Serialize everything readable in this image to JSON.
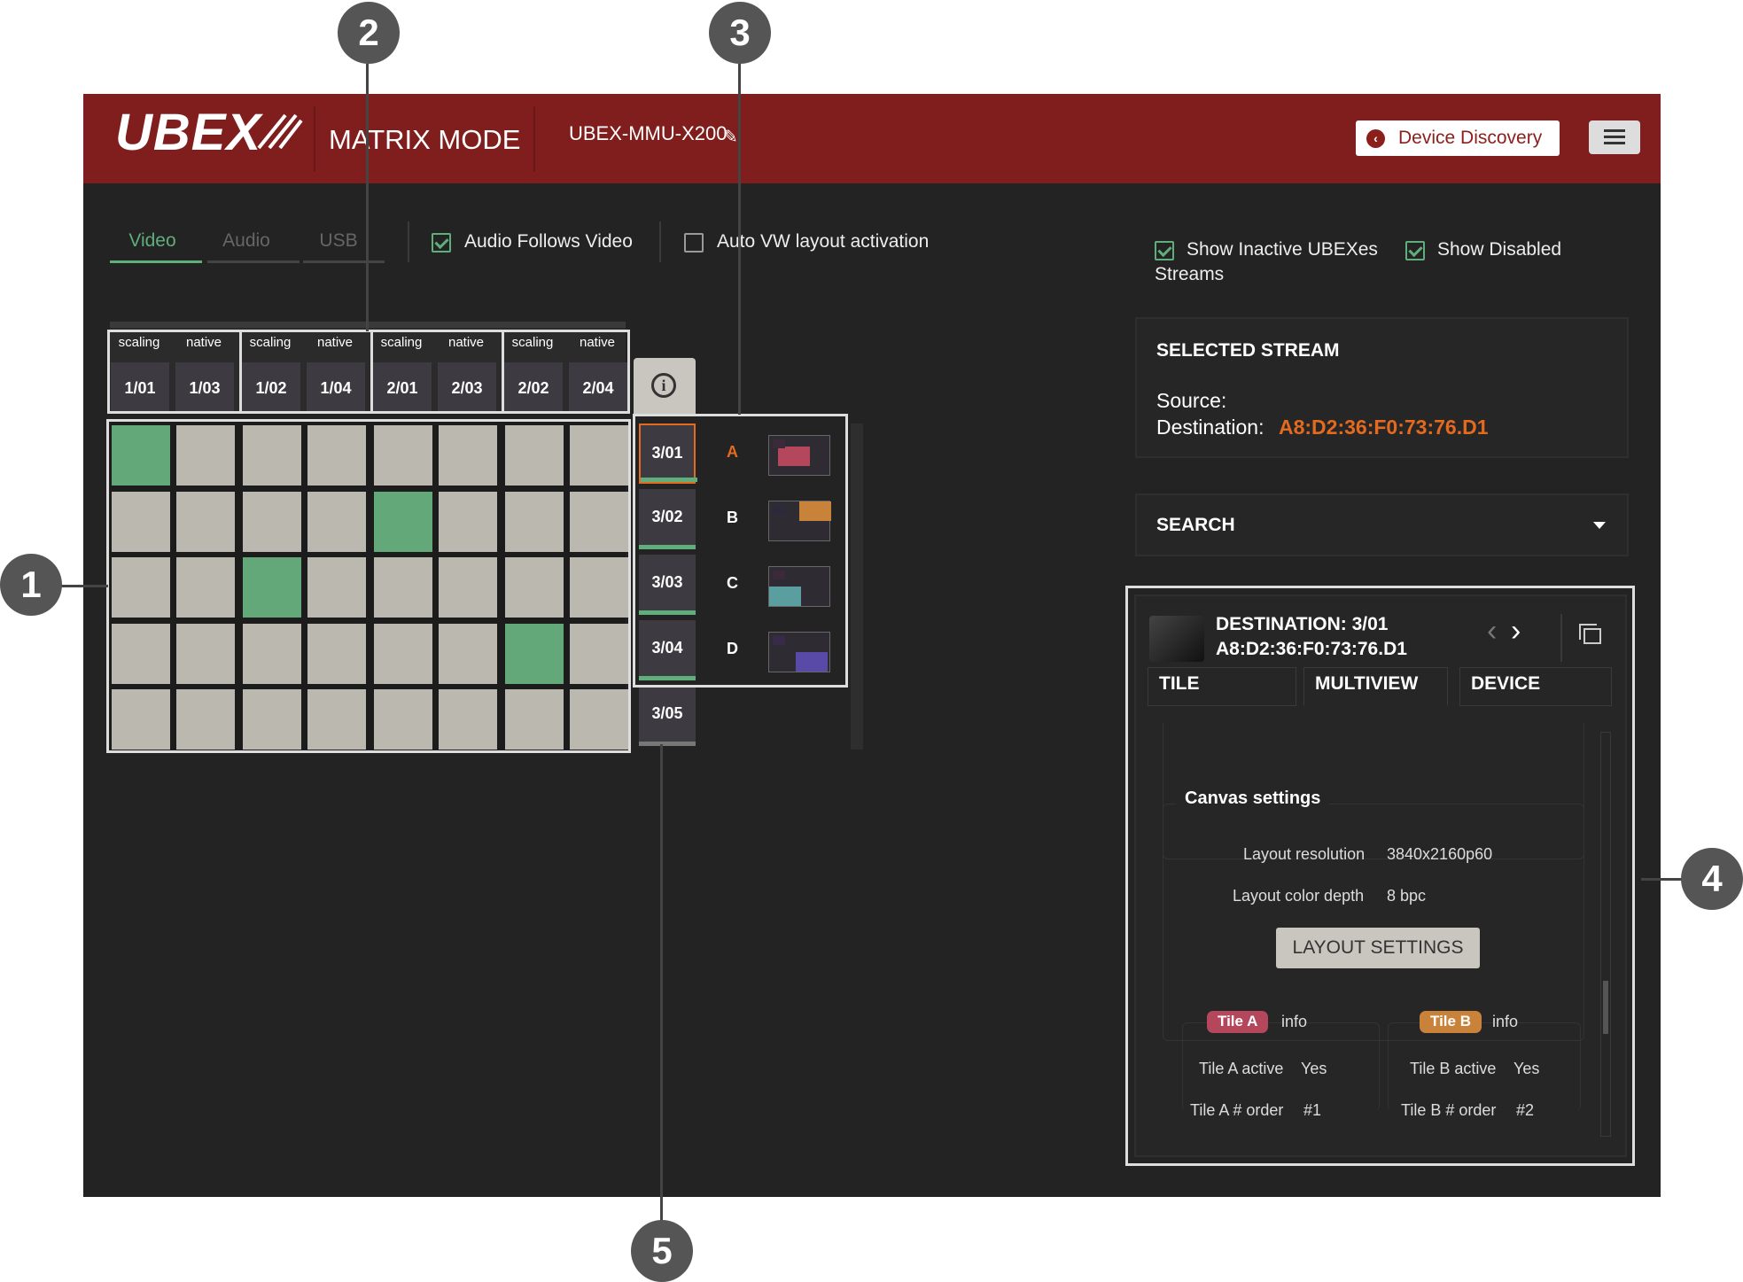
{
  "header": {
    "logo": "UBEX",
    "mode": "MATRIX MODE",
    "device_name": "UBEX-MMU-X200",
    "discovery_label": "Device Discovery"
  },
  "tabs": [
    {
      "label": "Video",
      "active": true
    },
    {
      "label": "Audio",
      "active": false
    },
    {
      "label": "USB",
      "active": false
    }
  ],
  "options": {
    "audio_follows_video": {
      "label": "Audio Follows Video",
      "checked": true
    },
    "auto_vw": {
      "label": "Auto VW layout activation",
      "checked": false
    },
    "show_inactive": {
      "label": "Show Inactive UBEXes",
      "checked": true
    },
    "show_disabled": {
      "label": "Show Disabled",
      "checked": true
    },
    "streams_label": "Streams"
  },
  "sources": [
    {
      "mode": "scaling",
      "id": "1/01"
    },
    {
      "mode": "native",
      "id": "1/03"
    },
    {
      "mode": "scaling",
      "id": "1/02"
    },
    {
      "mode": "native",
      "id": "1/04"
    },
    {
      "mode": "scaling",
      "id": "2/01"
    },
    {
      "mode": "native",
      "id": "2/03"
    },
    {
      "mode": "scaling",
      "id": "2/02"
    },
    {
      "mode": "native",
      "id": "2/04"
    }
  ],
  "destinations": [
    {
      "id": "3/01",
      "tile": "A"
    },
    {
      "id": "3/02",
      "tile": "B"
    },
    {
      "id": "3/03",
      "tile": "C"
    },
    {
      "id": "3/04",
      "tile": "D"
    },
    {
      "id": "3/05",
      "tile": ""
    }
  ],
  "crosspoints": [
    [
      0,
      0
    ],
    [
      1,
      4
    ],
    [
      2,
      2
    ],
    [
      3,
      6
    ]
  ],
  "selected_stream": {
    "title": "SELECTED STREAM",
    "source_label": "Source:",
    "destination_label": "Destination:",
    "destination_value": "A8:D2:36:F0:73:76.D1"
  },
  "search": {
    "label": "SEARCH"
  },
  "destination_panel": {
    "title": "DESTINATION: 3/01",
    "address": "A8:D2:36:F0:73:76.D1",
    "tabs": [
      "TILE",
      "MULTIVIEW",
      "DEVICE"
    ],
    "canvas_title": "Canvas settings",
    "layout_resolution_label": "Layout resolution",
    "layout_resolution_value": "3840x2160p60",
    "color_depth_label": "Layout color depth",
    "color_depth_value": "8 bpc",
    "layout_settings_btn": "LAYOUT SETTINGS",
    "tile_a": {
      "pill": "Tile A",
      "info": "info",
      "active_label": "Tile A active",
      "active_value": "Yes",
      "order_label": "Tile A # order",
      "order_value": "#1"
    },
    "tile_b": {
      "pill": "Tile B",
      "info": "info",
      "active_label": "Tile B active",
      "active_value": "Yes",
      "order_label": "Tile B # order",
      "order_value": "#2"
    }
  },
  "callouts": [
    "1",
    "2",
    "3",
    "4",
    "5"
  ],
  "colors": {
    "header": "#7f1e1c",
    "active_cell": "#63a878",
    "accent_orange": "#e36a1f",
    "tile_a": "#b5475d",
    "tile_b": "#c8823a"
  }
}
